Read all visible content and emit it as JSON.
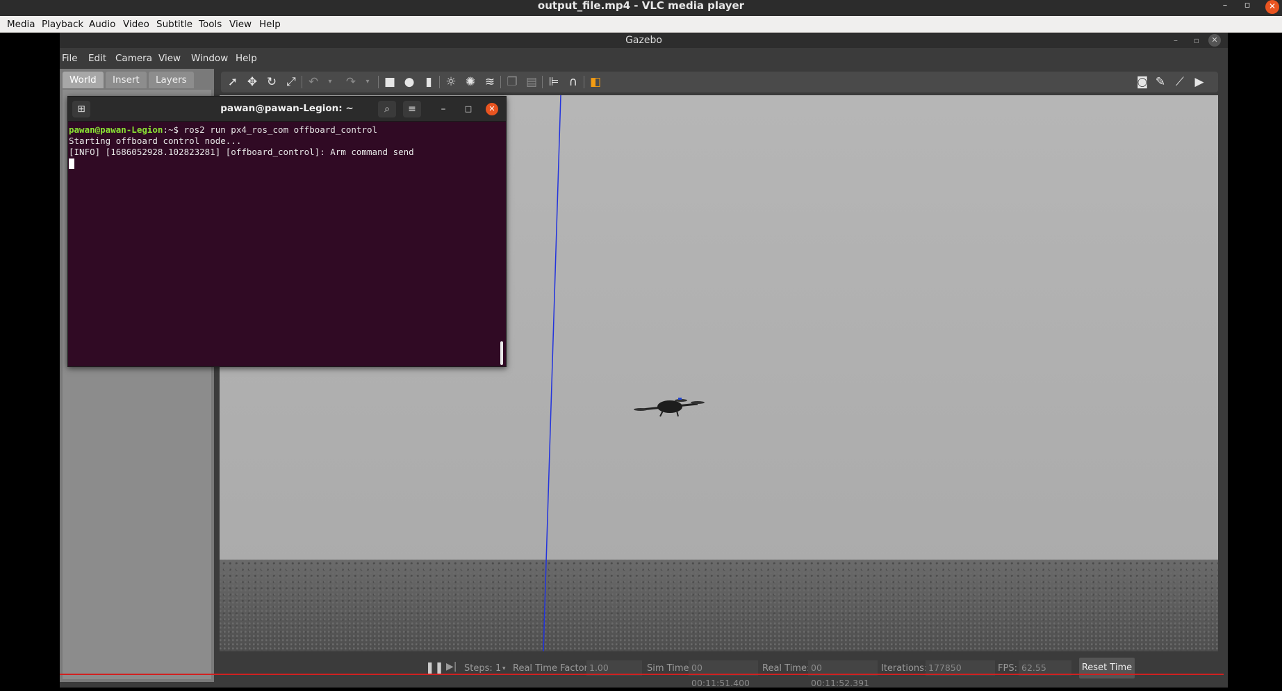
{
  "vlc": {
    "title": "output_file.mp4 - VLC media player",
    "menu": [
      "Media",
      "Playback",
      "Audio",
      "Video",
      "Subtitle",
      "Tools",
      "View",
      "Help"
    ],
    "minimize": "–",
    "maximize": "▫",
    "close": "✕"
  },
  "gazebo": {
    "title": "Gazebo",
    "menu": [
      "File",
      "Edit",
      "Camera",
      "View",
      "Window",
      "Help"
    ],
    "tabs": [
      "World",
      "Insert",
      "Layers"
    ],
    "status": {
      "steps_label": "Steps:",
      "steps_value": "1",
      "rtf_label": "Real Time Factor:",
      "rtf_value": "1.00",
      "sim_time_label": "Sim Time:",
      "sim_time_value": "00 00:11:51.400",
      "real_time_label": "Real Time:",
      "real_time_value": "00 00:11:52.391",
      "iterations_label": "Iterations:",
      "iterations_value": "177850",
      "fps_label": "FPS:",
      "fps_value": "62.55",
      "reset_label": "Reset Time"
    }
  },
  "terminal": {
    "title": "pawan@pawan-Legion: ~",
    "prompt_user": "pawan@pawan-Legion",
    "prompt_suffix": ":~$ ",
    "command": "ros2 run px4_ros_com offboard_control",
    "line2": "Starting offboard control node...",
    "line3": "[INFO] [1686052928.102823281] [offboard_control]: Arm command send"
  }
}
